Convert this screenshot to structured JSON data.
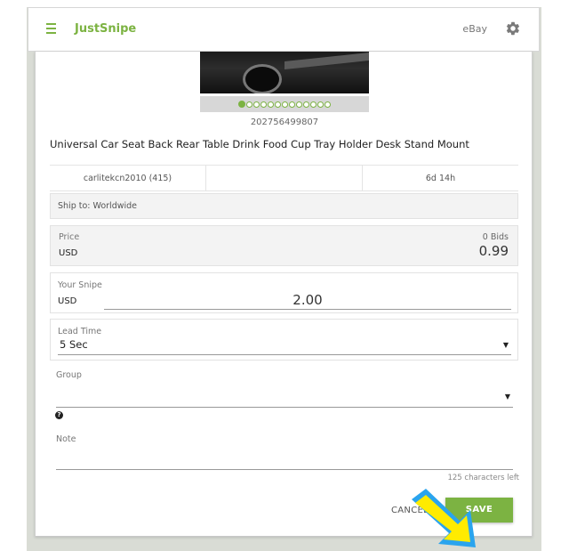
{
  "app": {
    "brand": "JustSnipe",
    "marketplace": "eBay",
    "accent_color": "#7cb342"
  },
  "listing": {
    "image_alt": "car cup holder tray photo",
    "carousel_total": 13,
    "carousel_active": 1,
    "item_id": "202756499807",
    "title": "Universal Car Seat Back Rear Table Drink Food Cup Tray Holder Desk Stand Mount",
    "seller": "carlitekcn2010 (415)",
    "middle_cell": "",
    "time_left": "6d 14h",
    "ship_to": "Ship to: Worldwide"
  },
  "price": {
    "label": "Price",
    "bids": "0 Bids",
    "currency": "USD",
    "value": "0.99"
  },
  "snipe": {
    "label": "Your Snipe",
    "currency": "USD",
    "value": "2.00"
  },
  "lead_time": {
    "label": "Lead Time",
    "selected": "5 Sec"
  },
  "group": {
    "label": "Group",
    "selected": ""
  },
  "note": {
    "label": "Note",
    "value": "",
    "chars_left": "125 characters left"
  },
  "actions": {
    "cancel": "CANCEL",
    "save": "SAVE"
  },
  "icons": {
    "menu": "hamburger-icon",
    "settings": "gear-icon",
    "help": "question-icon",
    "dropdown": "caret-down-icon"
  }
}
